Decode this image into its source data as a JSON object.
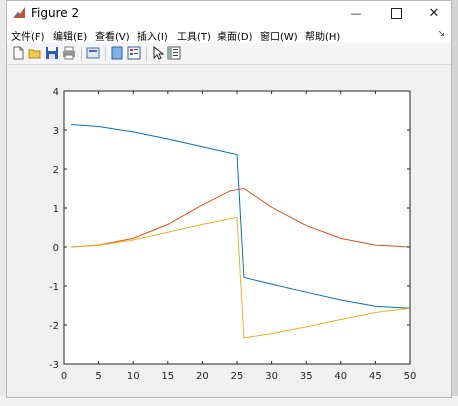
{
  "window": {
    "title": "Figure 2",
    "minimize": "—",
    "close": "✕"
  },
  "menu": [
    "文件(F)",
    "编辑(E)",
    "查看(V)",
    "插入(I)",
    "工具(T)",
    "桌面(D)",
    "窗口(W)",
    "帮助(H)"
  ],
  "menu_overflow": "↘",
  "toolbar_icons": [
    "new-figure-icon",
    "open-file-icon",
    "save-icon",
    "print-icon",
    "print-preview-icon",
    "dock-icon",
    "insert-legend-icon",
    "pointer-icon",
    "property-inspector-icon"
  ],
  "colors": {
    "series1": "#0072BD",
    "series2": "#D95319",
    "series3": "#EDB120"
  },
  "chart_data": {
    "type": "line",
    "title": "",
    "xlabel": "",
    "ylabel": "",
    "xlim": [
      0,
      50
    ],
    "ylim": [
      -3,
      4
    ],
    "xticks": [
      0,
      5,
      10,
      15,
      20,
      25,
      30,
      35,
      40,
      45,
      50
    ],
    "yticks": [
      -3,
      -2,
      -1,
      0,
      1,
      2,
      3,
      4
    ],
    "grid": false,
    "series": [
      {
        "color": "#0072BD",
        "x": [
          1,
          5,
          10,
          15,
          20,
          25,
          26,
          30,
          35,
          40,
          45,
          50
        ],
        "y": [
          3.14,
          3.09,
          2.95,
          2.77,
          2.57,
          2.37,
          -0.78,
          -0.95,
          -1.16,
          -1.36,
          -1.52,
          -1.57
        ]
      },
      {
        "color": "#D95319",
        "x": [
          1,
          5,
          10,
          15,
          20,
          24,
          26,
          30,
          35,
          40,
          45,
          50
        ],
        "y": [
          0.0,
          0.05,
          0.22,
          0.58,
          1.08,
          1.44,
          1.5,
          1.02,
          0.55,
          0.22,
          0.05,
          0.0
        ]
      },
      {
        "color": "#EDB120",
        "x": [
          1,
          5,
          10,
          15,
          20,
          25,
          26,
          30,
          35,
          40,
          45,
          50
        ],
        "y": [
          0.0,
          0.04,
          0.18,
          0.38,
          0.58,
          0.76,
          -2.33,
          -2.22,
          -2.05,
          -1.86,
          -1.68,
          -1.57
        ]
      }
    ]
  }
}
